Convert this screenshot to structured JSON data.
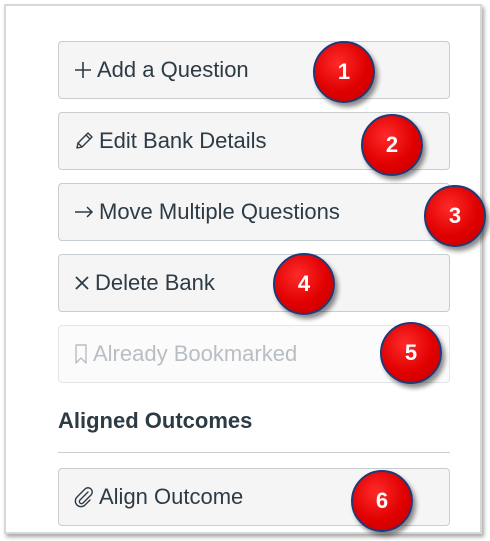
{
  "actions": {
    "add_question": {
      "icon": "plus-icon",
      "label": "Add a Question"
    },
    "edit_bank": {
      "icon": "pencil-icon",
      "label": "Edit Bank Details"
    },
    "move_questions": {
      "icon": "arrow-right-icon",
      "label": "Move Multiple Questions"
    },
    "delete_bank": {
      "icon": "x-icon",
      "label": "Delete Bank"
    },
    "bookmarked": {
      "icon": "bookmark-icon",
      "label": "Already Bookmarked"
    }
  },
  "aligned_outcomes": {
    "title": "Aligned Outcomes",
    "align_outcome": {
      "icon": "paperclip-icon",
      "label": "Align Outcome"
    }
  },
  "annotations": [
    "1",
    "2",
    "3",
    "4",
    "5",
    "6"
  ],
  "colors": {
    "badge": "#e00000",
    "badge_border": "#1f3a78",
    "text": "#2d3b45",
    "button_bg": "#f5f5f5"
  }
}
